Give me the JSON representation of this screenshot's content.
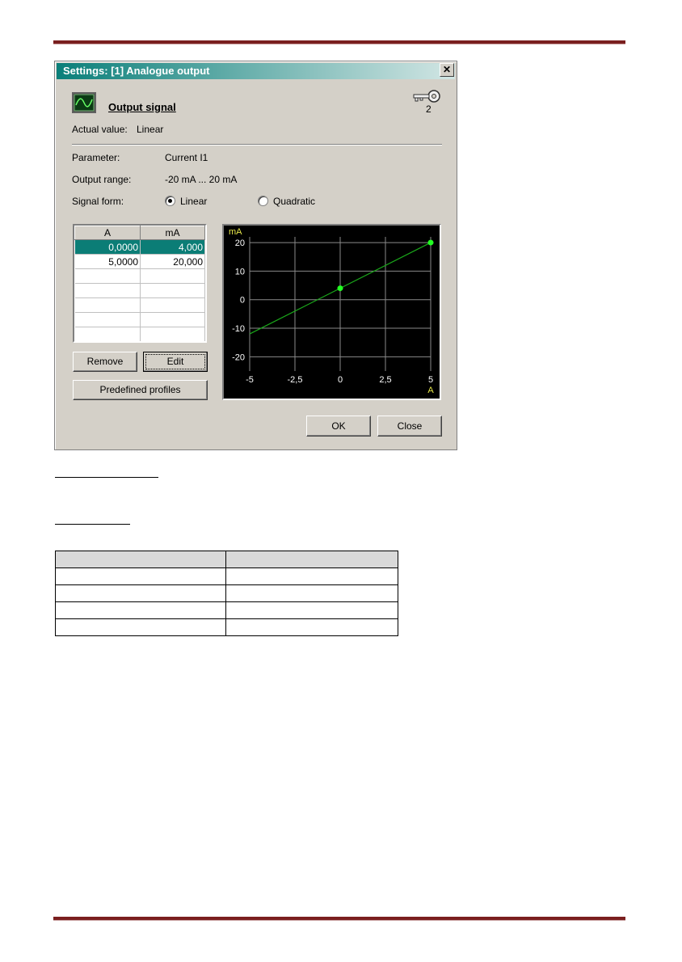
{
  "dialog": {
    "title": "Settings: [1] Analogue output",
    "close_label": "✕",
    "section_title": "Output signal",
    "access_level": "2",
    "actual_value_label": "Actual value:",
    "actual_value": "Linear",
    "parameter_label": "Parameter:",
    "parameter_value": "Current I1",
    "output_range_label": "Output range:",
    "output_range_value": "-20 mA ... 20 mA",
    "signal_form_label": "Signal form:",
    "signal_options": [
      "Linear",
      "Quadratic"
    ],
    "signal_selected": "Linear",
    "table": {
      "headers": [
        "A",
        "mA"
      ],
      "rows": [
        [
          "0,0000",
          "4,000"
        ],
        [
          "5,0000",
          "20,000"
        ]
      ],
      "selected_row": 0
    },
    "buttons": {
      "remove": "Remove",
      "edit": "Edit",
      "predefined": "Predefined profiles",
      "ok": "OK",
      "close": "Close"
    }
  },
  "chart_data": {
    "type": "line",
    "xlabel": "A",
    "ylabel": "mA",
    "xlim": [
      -5,
      5
    ],
    "ylim": [
      -25,
      22
    ],
    "x_ticks": [
      "-5",
      "-2,5",
      "0",
      "2,5",
      "5"
    ],
    "y_ticks": [
      "20",
      "10",
      "0",
      "-10",
      "-20"
    ],
    "grid": true,
    "series": [
      {
        "x": [
          -5,
          5
        ],
        "y": [
          -12,
          20
        ]
      }
    ],
    "points": [
      {
        "x": 0,
        "y": 4
      },
      {
        "x": 5,
        "y": 20
      }
    ],
    "colors": {
      "line": "#1aa81a",
      "point": "#22ff22",
      "axis_label": "#e8e84a",
      "grid": "#8a8a8a",
      "text": "#ffffff"
    }
  },
  "colors": {
    "accent": "#0a7f7a",
    "dialog_bg": "#d4d0c8",
    "rule": "#7a1f1f"
  }
}
